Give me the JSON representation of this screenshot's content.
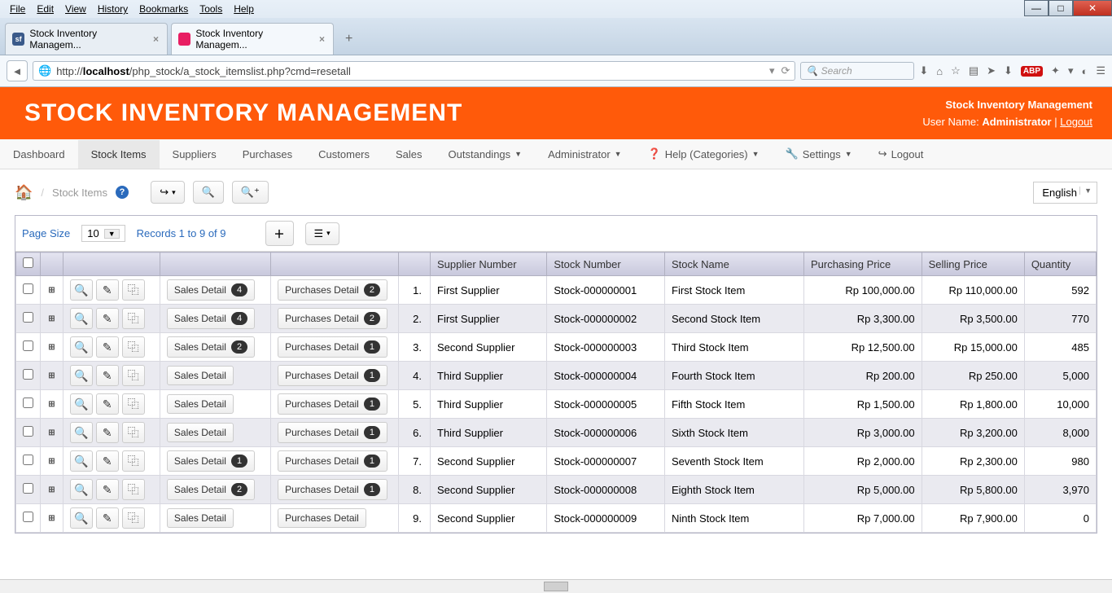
{
  "window": {
    "menus": [
      "File",
      "Edit",
      "View",
      "History",
      "Bookmarks",
      "Tools",
      "Help"
    ]
  },
  "tabs": [
    {
      "title": "Stock Inventory Managem...",
      "fav": "sf"
    },
    {
      "title": "Stock Inventory Managem...",
      "fav": "w",
      "active": true
    }
  ],
  "url": {
    "prefix": "http://",
    "host": "localhost",
    "path": "/php_stock/a_stock_itemslist.php?cmd=resetall"
  },
  "search_placeholder": "Search",
  "banner": {
    "title": "STOCK INVENTORY MANAGEMENT",
    "app": "Stock Inventory Management",
    "user_label": "User Name:",
    "user": "Administrator",
    "logout": "Logout"
  },
  "nav": {
    "items": [
      "Dashboard",
      "Stock Items",
      "Suppliers",
      "Purchases",
      "Customers",
      "Sales",
      "Outstandings",
      "Administrator",
      "Help (Categories)",
      "Settings",
      "Logout"
    ],
    "active": "Stock Items"
  },
  "breadcrumb": "Stock Items",
  "language": "English",
  "table_ctrl": {
    "page_size_label": "Page Size",
    "page_size": "10",
    "records": "Records 1 to 9 of 9"
  },
  "headers": [
    "",
    "",
    "",
    "",
    "",
    "",
    "Supplier Number",
    "Stock Number",
    "Stock Name",
    "Purchasing Price",
    "Selling Price",
    "Quantity"
  ],
  "sales_label": "Sales Detail",
  "purchases_label": "Purchases Detail",
  "rows": [
    {
      "n": "1.",
      "sales": 4,
      "purch": 2,
      "sup": "First Supplier",
      "stkno": "Stock-000000001",
      "name": "First Stock Item",
      "pp": "Rp 100,000.00",
      "sp": "Rp 110,000.00",
      "qty": "592"
    },
    {
      "n": "2.",
      "sales": 4,
      "purch": 2,
      "sup": "First Supplier",
      "stkno": "Stock-000000002",
      "name": "Second Stock Item",
      "pp": "Rp 3,300.00",
      "sp": "Rp 3,500.00",
      "qty": "770"
    },
    {
      "n": "3.",
      "sales": 2,
      "purch": 1,
      "sup": "Second Supplier",
      "stkno": "Stock-000000003",
      "name": "Third Stock Item",
      "pp": "Rp 12,500.00",
      "sp": "Rp 15,000.00",
      "qty": "485"
    },
    {
      "n": "4.",
      "sales": null,
      "purch": 1,
      "sup": "Third Supplier",
      "stkno": "Stock-000000004",
      "name": "Fourth Stock Item",
      "pp": "Rp 200.00",
      "sp": "Rp 250.00",
      "qty": "5,000"
    },
    {
      "n": "5.",
      "sales": null,
      "purch": 1,
      "sup": "Third Supplier",
      "stkno": "Stock-000000005",
      "name": "Fifth Stock Item",
      "pp": "Rp 1,500.00",
      "sp": "Rp 1,800.00",
      "qty": "10,000"
    },
    {
      "n": "6.",
      "sales": null,
      "purch": 1,
      "sup": "Third Supplier",
      "stkno": "Stock-000000006",
      "name": "Sixth Stock Item",
      "pp": "Rp 3,000.00",
      "sp": "Rp 3,200.00",
      "qty": "8,000"
    },
    {
      "n": "7.",
      "sales": 1,
      "purch": 1,
      "sup": "Second Supplier",
      "stkno": "Stock-000000007",
      "name": "Seventh Stock Item",
      "pp": "Rp 2,000.00",
      "sp": "Rp 2,300.00",
      "qty": "980"
    },
    {
      "n": "8.",
      "sales": 2,
      "purch": 1,
      "sup": "Second Supplier",
      "stkno": "Stock-000000008",
      "name": "Eighth Stock Item",
      "pp": "Rp 5,000.00",
      "sp": "Rp 5,800.00",
      "qty": "3,970"
    },
    {
      "n": "9.",
      "sales": null,
      "purch": null,
      "sup": "Second Supplier",
      "stkno": "Stock-000000009",
      "name": "Ninth Stock Item",
      "pp": "Rp 7,000.00",
      "sp": "Rp 7,900.00",
      "qty": "0"
    }
  ]
}
